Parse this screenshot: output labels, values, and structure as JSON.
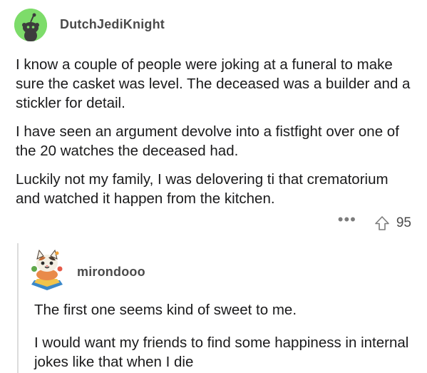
{
  "parent_comment": {
    "username": "DutchJediKnight",
    "avatar_icon": "reddit-snoo-avatar-icon",
    "paragraphs": [
      "I know a couple of people were joking at a funeral to make sure the casket was level. The deceased was a builder and a stickler for detail.",
      "I have seen an argument devolve into a fistfight over one of the 20 watches the deceased had.",
      "Luckily not my family, I was delovering ti that crematorium and watched it happen from the kitchen."
    ],
    "more_label": "•••",
    "upvote_icon": "upvote-arrow-icon",
    "vote_count": "95"
  },
  "reply_comment": {
    "username": "mirondooo",
    "avatar_icon": "custom-cat-avatar-icon",
    "paragraphs": [
      "The first one seems kind of sweet to me.",
      "I would want my friends to find some happiness in internal jokes like that when I die"
    ]
  },
  "colors": {
    "avatar_green": "#7ddc6a",
    "text": "#1a1a1b",
    "muted": "#7c7c7c",
    "thread_line": "#dcdcdc"
  }
}
